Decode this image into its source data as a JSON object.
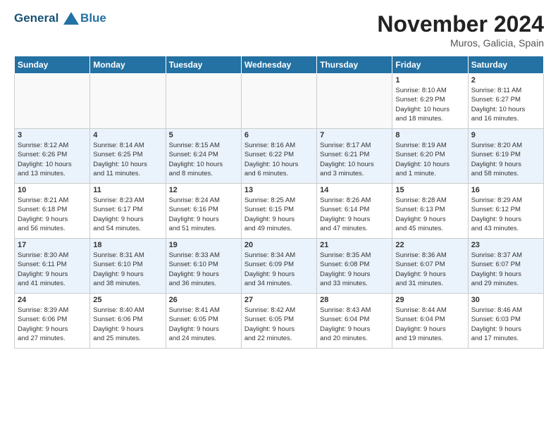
{
  "header": {
    "logo_line1": "General",
    "logo_line2": "Blue",
    "month": "November 2024",
    "location": "Muros, Galicia, Spain"
  },
  "weekdays": [
    "Sunday",
    "Monday",
    "Tuesday",
    "Wednesday",
    "Thursday",
    "Friday",
    "Saturday"
  ],
  "weeks": [
    [
      {
        "day": "",
        "info": ""
      },
      {
        "day": "",
        "info": ""
      },
      {
        "day": "",
        "info": ""
      },
      {
        "day": "",
        "info": ""
      },
      {
        "day": "",
        "info": ""
      },
      {
        "day": "1",
        "info": "Sunrise: 8:10 AM\nSunset: 6:29 PM\nDaylight: 10 hours\nand 18 minutes."
      },
      {
        "day": "2",
        "info": "Sunrise: 8:11 AM\nSunset: 6:27 PM\nDaylight: 10 hours\nand 16 minutes."
      }
    ],
    [
      {
        "day": "3",
        "info": "Sunrise: 8:12 AM\nSunset: 6:26 PM\nDaylight: 10 hours\nand 13 minutes."
      },
      {
        "day": "4",
        "info": "Sunrise: 8:14 AM\nSunset: 6:25 PM\nDaylight: 10 hours\nand 11 minutes."
      },
      {
        "day": "5",
        "info": "Sunrise: 8:15 AM\nSunset: 6:24 PM\nDaylight: 10 hours\nand 8 minutes."
      },
      {
        "day": "6",
        "info": "Sunrise: 8:16 AM\nSunset: 6:22 PM\nDaylight: 10 hours\nand 6 minutes."
      },
      {
        "day": "7",
        "info": "Sunrise: 8:17 AM\nSunset: 6:21 PM\nDaylight: 10 hours\nand 3 minutes."
      },
      {
        "day": "8",
        "info": "Sunrise: 8:19 AM\nSunset: 6:20 PM\nDaylight: 10 hours\nand 1 minute."
      },
      {
        "day": "9",
        "info": "Sunrise: 8:20 AM\nSunset: 6:19 PM\nDaylight: 9 hours\nand 58 minutes."
      }
    ],
    [
      {
        "day": "10",
        "info": "Sunrise: 8:21 AM\nSunset: 6:18 PM\nDaylight: 9 hours\nand 56 minutes."
      },
      {
        "day": "11",
        "info": "Sunrise: 8:23 AM\nSunset: 6:17 PM\nDaylight: 9 hours\nand 54 minutes."
      },
      {
        "day": "12",
        "info": "Sunrise: 8:24 AM\nSunset: 6:16 PM\nDaylight: 9 hours\nand 51 minutes."
      },
      {
        "day": "13",
        "info": "Sunrise: 8:25 AM\nSunset: 6:15 PM\nDaylight: 9 hours\nand 49 minutes."
      },
      {
        "day": "14",
        "info": "Sunrise: 8:26 AM\nSunset: 6:14 PM\nDaylight: 9 hours\nand 47 minutes."
      },
      {
        "day": "15",
        "info": "Sunrise: 8:28 AM\nSunset: 6:13 PM\nDaylight: 9 hours\nand 45 minutes."
      },
      {
        "day": "16",
        "info": "Sunrise: 8:29 AM\nSunset: 6:12 PM\nDaylight: 9 hours\nand 43 minutes."
      }
    ],
    [
      {
        "day": "17",
        "info": "Sunrise: 8:30 AM\nSunset: 6:11 PM\nDaylight: 9 hours\nand 41 minutes."
      },
      {
        "day": "18",
        "info": "Sunrise: 8:31 AM\nSunset: 6:10 PM\nDaylight: 9 hours\nand 38 minutes."
      },
      {
        "day": "19",
        "info": "Sunrise: 8:33 AM\nSunset: 6:10 PM\nDaylight: 9 hours\nand 36 minutes."
      },
      {
        "day": "20",
        "info": "Sunrise: 8:34 AM\nSunset: 6:09 PM\nDaylight: 9 hours\nand 34 minutes."
      },
      {
        "day": "21",
        "info": "Sunrise: 8:35 AM\nSunset: 6:08 PM\nDaylight: 9 hours\nand 33 minutes."
      },
      {
        "day": "22",
        "info": "Sunrise: 8:36 AM\nSunset: 6:07 PM\nDaylight: 9 hours\nand 31 minutes."
      },
      {
        "day": "23",
        "info": "Sunrise: 8:37 AM\nSunset: 6:07 PM\nDaylight: 9 hours\nand 29 minutes."
      }
    ],
    [
      {
        "day": "24",
        "info": "Sunrise: 8:39 AM\nSunset: 6:06 PM\nDaylight: 9 hours\nand 27 minutes."
      },
      {
        "day": "25",
        "info": "Sunrise: 8:40 AM\nSunset: 6:06 PM\nDaylight: 9 hours\nand 25 minutes."
      },
      {
        "day": "26",
        "info": "Sunrise: 8:41 AM\nSunset: 6:05 PM\nDaylight: 9 hours\nand 24 minutes."
      },
      {
        "day": "27",
        "info": "Sunrise: 8:42 AM\nSunset: 6:05 PM\nDaylight: 9 hours\nand 22 minutes."
      },
      {
        "day": "28",
        "info": "Sunrise: 8:43 AM\nSunset: 6:04 PM\nDaylight: 9 hours\nand 20 minutes."
      },
      {
        "day": "29",
        "info": "Sunrise: 8:44 AM\nSunset: 6:04 PM\nDaylight: 9 hours\nand 19 minutes."
      },
      {
        "day": "30",
        "info": "Sunrise: 8:46 AM\nSunset: 6:03 PM\nDaylight: 9 hours\nand 17 minutes."
      }
    ]
  ]
}
